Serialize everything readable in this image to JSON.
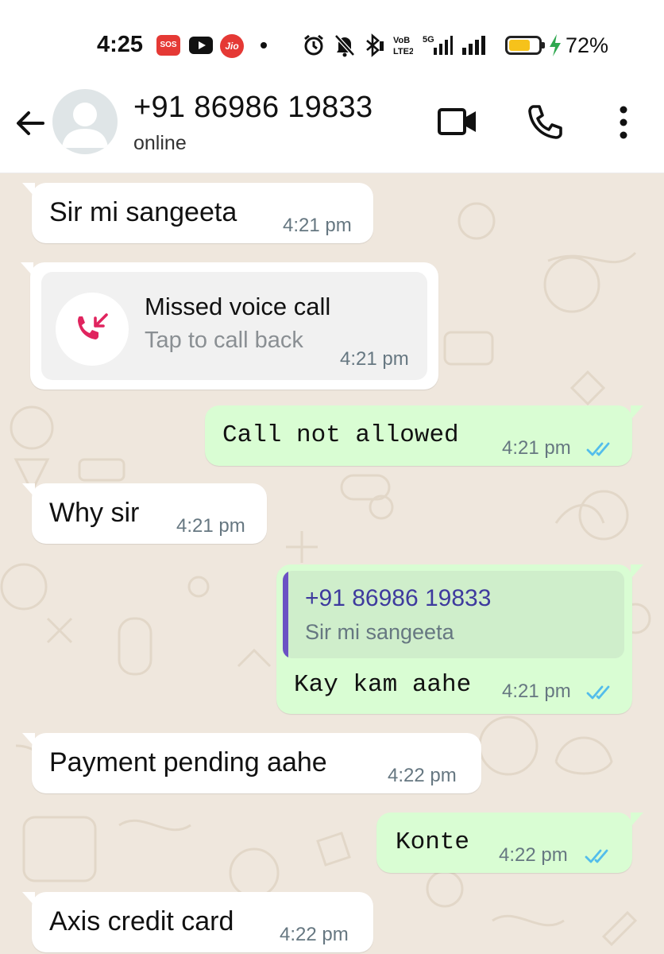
{
  "status_bar": {
    "time": "4:25",
    "sos_label": "SOS",
    "jio_label": "Jio",
    "battery_percent": "72%",
    "battery_level": 0.72,
    "icons": [
      "sos-icon",
      "youtube-icon",
      "jio-icon",
      "notification-dot-icon",
      "alarm-icon",
      "mute-icon",
      "bluetooth-icon",
      "volte-icon",
      "5g-signal-icon",
      "signal-icon",
      "battery-icon",
      "charging-icon"
    ]
  },
  "header": {
    "contact_name": "+91 86986 19833",
    "status": "online",
    "icons": [
      "back-arrow-icon",
      "avatar-icon",
      "video-call-icon",
      "voice-call-icon",
      "more-options-icon"
    ]
  },
  "messages": [
    {
      "direction": "in",
      "text": "Sir mi sangeeta",
      "time": "4:21 pm"
    },
    {
      "direction": "in",
      "type": "missed_call",
      "title": "Missed voice call",
      "subtitle": "Tap to call back",
      "time": "4:21 pm"
    },
    {
      "direction": "out",
      "text": "Call not allowed",
      "time": "4:21 pm",
      "read": true
    },
    {
      "direction": "in",
      "text": "Why sir",
      "time": "4:21 pm"
    },
    {
      "direction": "out",
      "type": "reply",
      "quote_author": "+91 86986 19833",
      "quote_text": "Sir mi sangeeta",
      "text": "Kay kam aahe",
      "time": "4:21 pm",
      "read": true
    },
    {
      "direction": "in",
      "text": "Payment pending aahe",
      "time": "4:22 pm"
    },
    {
      "direction": "out",
      "text": "Konte",
      "time": "4:22 pm",
      "read": true
    },
    {
      "direction": "in",
      "text": "Axis credit card",
      "time": "4:22 pm"
    }
  ],
  "colors": {
    "chat_background": "#efe7dd",
    "incoming_bubble": "#ffffff",
    "outgoing_bubble": "#d9fdd3",
    "read_ticks": "#53bdeb",
    "missed_call": "#e0245e",
    "quote_accent": "#6b52c4"
  }
}
